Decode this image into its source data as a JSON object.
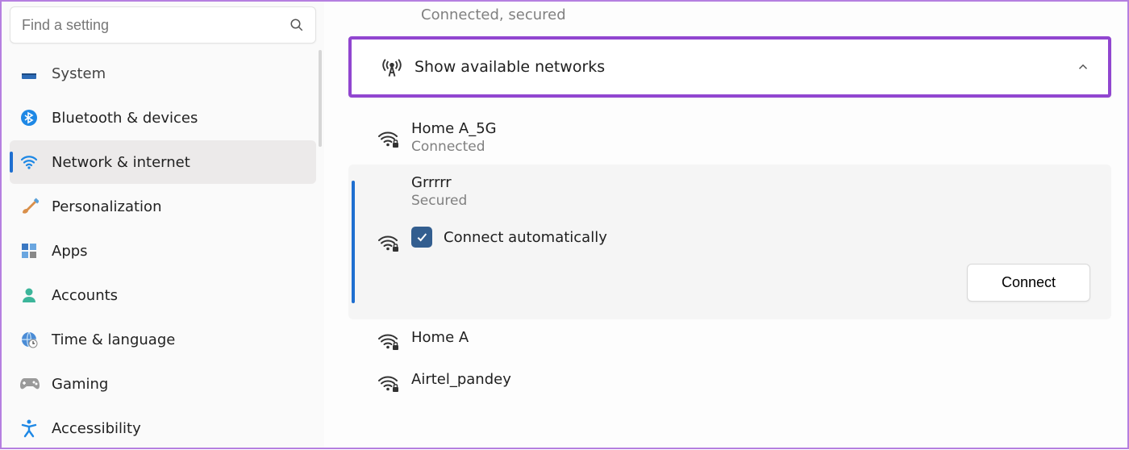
{
  "search": {
    "placeholder": "Find a setting"
  },
  "sidebar": {
    "items": [
      {
        "label": "System"
      },
      {
        "label": "Bluetooth & devices"
      },
      {
        "label": "Network & internet"
      },
      {
        "label": "Personalization"
      },
      {
        "label": "Apps"
      },
      {
        "label": "Accounts"
      },
      {
        "label": "Time & language"
      },
      {
        "label": "Gaming"
      },
      {
        "label": "Accessibility"
      }
    ]
  },
  "main": {
    "top_status": "Connected, secured",
    "expand_label": "Show available networks",
    "networks": [
      {
        "name": "Home A_5G",
        "sub": "Connected"
      },
      {
        "name": "Grrrrr",
        "sub": "Secured",
        "auto_label": "Connect automatically"
      },
      {
        "name": "Home A",
        "sub": ""
      },
      {
        "name": "Airtel_pandey",
        "sub": ""
      }
    ],
    "connect_label": "Connect"
  }
}
